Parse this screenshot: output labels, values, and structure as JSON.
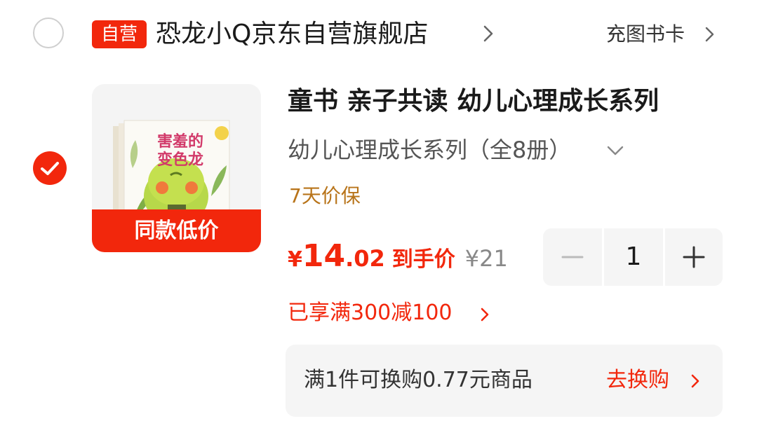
{
  "store": {
    "badge": "自营",
    "name": "恐龙小Q京东自营旗舰店",
    "topup_link": "充图书卡"
  },
  "item": {
    "title": "童书 亲子共读  幼儿心理成长系列",
    "spec": "幼儿心理成长系列（全8册）",
    "guarantee": "7天价保",
    "thumbnail_tag": "同款低价",
    "thumbnail_book_title": "害羞的变色龙",
    "price": {
      "symbol": "¥",
      "integer": "14",
      "decimal": ".02",
      "label": "到手价",
      "original": "¥21"
    },
    "quantity": "1",
    "promo": "已享满300减100",
    "selected": true
  },
  "exchange": {
    "text": "满1件可换购0.77元商品",
    "action": "去换购"
  },
  "colors": {
    "accent": "#f2270c",
    "guarantee": "#b8741a",
    "muted": "#888888",
    "panel": "#f5f5f5"
  }
}
